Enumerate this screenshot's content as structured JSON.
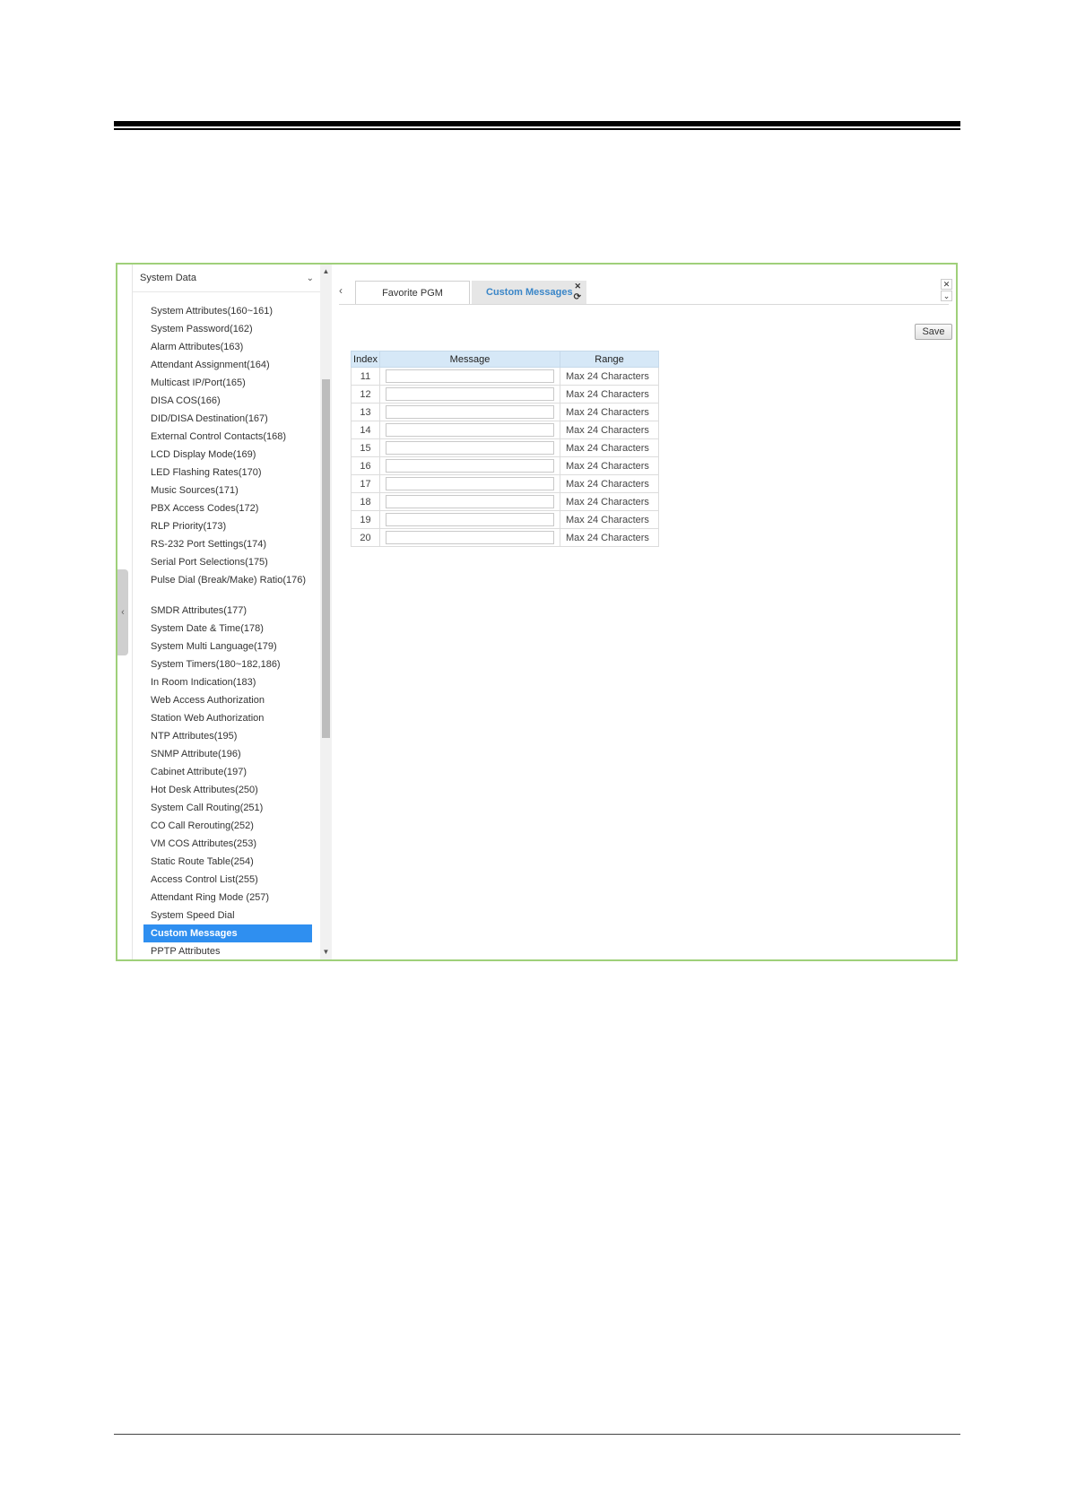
{
  "sidebar": {
    "title": "System Data",
    "items": [
      {
        "label": "System Attributes(160~161)"
      },
      {
        "label": "System Password(162)"
      },
      {
        "label": "Alarm Attributes(163)"
      },
      {
        "label": "Attendant Assignment(164)"
      },
      {
        "label": "Multicast IP/Port(165)"
      },
      {
        "label": "DISA COS(166)"
      },
      {
        "label": "DID/DISA Destination(167)"
      },
      {
        "label": "External Control Contacts(168)"
      },
      {
        "label": "LCD Display Mode(169)"
      },
      {
        "label": "LED Flashing Rates(170)"
      },
      {
        "label": "Music Sources(171)"
      },
      {
        "label": "PBX Access Codes(172)"
      },
      {
        "label": "RLP Priority(173)"
      },
      {
        "label": "RS-232 Port Settings(174)"
      },
      {
        "label": "Serial Port Selections(175)"
      },
      {
        "label": "Pulse Dial (Break/Make) Ratio(176)"
      },
      {
        "label": "SMDR Attributes(177)"
      },
      {
        "label": "System Date & Time(178)"
      },
      {
        "label": "System Multi Language(179)"
      },
      {
        "label": "System Timers(180~182,186)"
      },
      {
        "label": "In Room Indication(183)"
      },
      {
        "label": "Web Access Authorization"
      },
      {
        "label": "Station Web Authorization"
      },
      {
        "label": "NTP Attributes(195)"
      },
      {
        "label": "SNMP Attribute(196)"
      },
      {
        "label": "Cabinet Attribute(197)"
      },
      {
        "label": "Hot Desk Attributes(250)"
      },
      {
        "label": "System Call Routing(251)"
      },
      {
        "label": "CO Call Rerouting(252)"
      },
      {
        "label": "VM COS Attributes(253)"
      },
      {
        "label": "Static Route Table(254)"
      },
      {
        "label": "Access Control List(255)"
      },
      {
        "label": "Attendant Ring Mode (257)"
      },
      {
        "label": "System Speed Dial"
      },
      {
        "label": "Custom Messages"
      },
      {
        "label": "PPTP Attributes"
      }
    ]
  },
  "tabs": {
    "favorite": "Favorite PGM",
    "custom": "Custom Messages"
  },
  "toolbar": {
    "save_label": "Save"
  },
  "table": {
    "headers": [
      "Index",
      "Message",
      "Range"
    ],
    "rows": [
      {
        "index": "11",
        "message": "",
        "range": "Max 24 Characters"
      },
      {
        "index": "12",
        "message": "",
        "range": "Max 24 Characters"
      },
      {
        "index": "13",
        "message": "",
        "range": "Max 24 Characters"
      },
      {
        "index": "14",
        "message": "",
        "range": "Max 24 Characters"
      },
      {
        "index": "15",
        "message": "",
        "range": "Max 24 Characters"
      },
      {
        "index": "16",
        "message": "",
        "range": "Max 24 Characters"
      },
      {
        "index": "17",
        "message": "",
        "range": "Max 24 Characters"
      },
      {
        "index": "18",
        "message": "",
        "range": "Max 24 Characters"
      },
      {
        "index": "19",
        "message": "",
        "range": "Max 24 Characters"
      },
      {
        "index": "20",
        "message": "",
        "range": "Max 24 Characters"
      }
    ]
  },
  "colors": {
    "frame": "#9fd07a",
    "active": "#2f8ff0",
    "header": "#d6e8f7"
  },
  "icons": [
    "chevron-down-icon",
    "chevron-left-icon",
    "close-icon",
    "refresh-icon",
    "scroll-up-icon",
    "scroll-down-icon"
  ]
}
